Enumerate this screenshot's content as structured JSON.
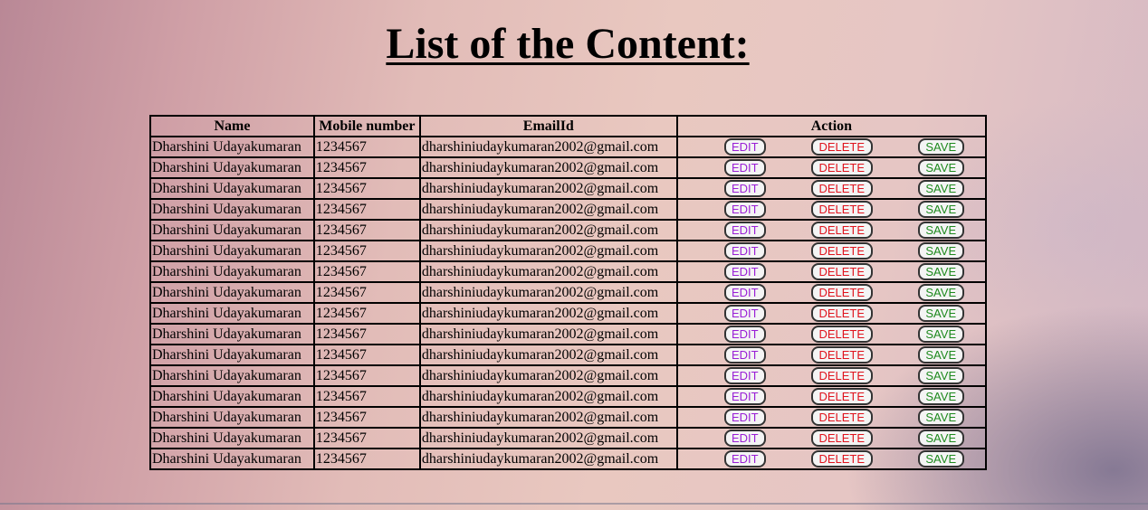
{
  "page": {
    "title": "List of the Content:"
  },
  "table": {
    "headers": [
      "Name",
      "Mobile number",
      "EmailId",
      "Action"
    ],
    "buttons": {
      "edit": "EDIT",
      "delete": "DELETE",
      "save": "SAVE"
    },
    "rows": [
      {
        "name": "Dharshini Udayakumaran",
        "mobile": "1234567",
        "email": "dharshiniudaykumaran2002@gmail.com"
      },
      {
        "name": "Dharshini Udayakumaran",
        "mobile": "1234567",
        "email": "dharshiniudaykumaran2002@gmail.com"
      },
      {
        "name": "Dharshini Udayakumaran",
        "mobile": "1234567",
        "email": "dharshiniudaykumaran2002@gmail.com"
      },
      {
        "name": "Dharshini Udayakumaran",
        "mobile": "1234567",
        "email": "dharshiniudaykumaran2002@gmail.com"
      },
      {
        "name": "Dharshini Udayakumaran",
        "mobile": "1234567",
        "email": "dharshiniudaykumaran2002@gmail.com"
      },
      {
        "name": "Dharshini Udayakumaran",
        "mobile": "1234567",
        "email": "dharshiniudaykumaran2002@gmail.com"
      },
      {
        "name": "Dharshini Udayakumaran",
        "mobile": "1234567",
        "email": "dharshiniudaykumaran2002@gmail.com"
      },
      {
        "name": "Dharshini Udayakumaran",
        "mobile": "1234567",
        "email": "dharshiniudaykumaran2002@gmail.com"
      },
      {
        "name": "Dharshini Udayakumaran",
        "mobile": "1234567",
        "email": "dharshiniudaykumaran2002@gmail.com"
      },
      {
        "name": "Dharshini Udayakumaran",
        "mobile": "1234567",
        "email": "dharshiniudaykumaran2002@gmail.com"
      },
      {
        "name": "Dharshini Udayakumaran",
        "mobile": "1234567",
        "email": "dharshiniudaykumaran2002@gmail.com"
      },
      {
        "name": "Dharshini Udayakumaran",
        "mobile": "1234567",
        "email": "dharshiniudaykumaran2002@gmail.com"
      },
      {
        "name": "Dharshini Udayakumaran",
        "mobile": "1234567",
        "email": "dharshiniudaykumaran2002@gmail.com"
      },
      {
        "name": "Dharshini Udayakumaran",
        "mobile": "1234567",
        "email": "dharshiniudaykumaran2002@gmail.com"
      },
      {
        "name": "Dharshini Udayakumaran",
        "mobile": "1234567",
        "email": "dharshiniudaykumaran2002@gmail.com"
      },
      {
        "name": "Dharshini Udayakumaran",
        "mobile": "1234567",
        "email": "dharshiniudaykumaran2002@gmail.com"
      }
    ]
  },
  "colors": {
    "edit": "#9a1fd6",
    "delete": "#e0141e",
    "save": "#1e8a1e"
  }
}
